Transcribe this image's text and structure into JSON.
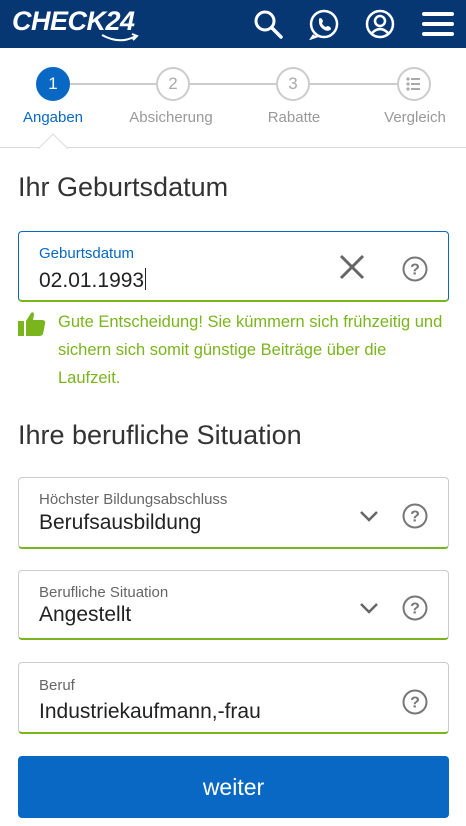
{
  "header": {
    "logo_text": "CHECK24",
    "icons": [
      "search-icon",
      "phone-chat-icon",
      "user-account-icon",
      "menu-icon"
    ]
  },
  "stepper": {
    "steps": [
      {
        "number": "1",
        "label": "Angaben",
        "active": true
      },
      {
        "number": "2",
        "label": "Absicherung",
        "active": false
      },
      {
        "number": "3",
        "label": "Rabatte",
        "active": false
      },
      {
        "number": "",
        "label": "Vergleich",
        "active": false,
        "icon": "list-icon"
      }
    ]
  },
  "birth_section": {
    "heading": "Ihr Geburtsdatum",
    "field": {
      "label": "Geburtsdatum",
      "value": "02.01.1993"
    },
    "hint": "Gute Entscheidung! Sie kümmern sich frühzeitig und sichern sich somit günstige Beiträge über die Laufzeit."
  },
  "job_section": {
    "heading": "Ihre berufliche Situation",
    "education": {
      "label": "Höchster Bildungsabschluss",
      "value": "Berufsausbildung"
    },
    "situation": {
      "label": "Berufliche Situation",
      "value": "Angestellt"
    },
    "occupation": {
      "label": "Beruf",
      "value": "Industriekaufmann,-frau"
    }
  },
  "submit_label": "weiter",
  "colors": {
    "brand": "#063773",
    "accent": "#0968c3",
    "success": "#7ab51d"
  }
}
